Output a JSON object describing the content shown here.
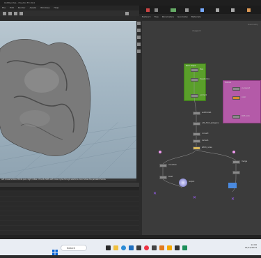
{
  "window": {
    "title": "Untitled.hip - Houdini FX 20.0"
  },
  "menubar": {
    "items": [
      "File",
      "Edit",
      "Render",
      "Assets",
      "Windows",
      "Help"
    ]
  },
  "network_tabs": {
    "items": [
      "Network",
      "Tree",
      "Parameters",
      "Geometry",
      "Materials"
    ]
  },
  "viewport": {
    "status_text": "Left mouse tumbles. Middle pans. Right dollies. Ctrl+Alt+Shift+Left mouse cycles through selections. Alt+P shows the persistent handle."
  },
  "network": {
    "context_label": "Geometry",
    "path": "obj/geo1",
    "nodes": [
      {
        "label": "file1"
      },
      {
        "label": "transform1"
      },
      {
        "label": "normal1"
      },
      {
        "label": "subdivide1"
      },
      {
        "label": "vdb_from_polygons"
      },
      {
        "label": "convert"
      },
      {
        "label": "remesh"
      },
      {
        "label": "attrib_noise"
      },
      {
        "label": "mountain"
      },
      {
        "label": "blast"
      },
      {
        "label": "output"
      },
      {
        "label": "merge"
      },
      {
        "label": "uv_layout"
      },
      {
        "label": "color"
      },
      {
        "label": "OUT_rock"
      }
    ],
    "green_box": {
      "label": "Rock shape"
    },
    "pink_box": {
      "label": "Texture"
    }
  },
  "taskbar": {
    "search_placeholder": "Search",
    "time": "12:00",
    "date": "01/01/2024"
  },
  "colors": {
    "viewport_sky": "#a4b7c4",
    "net_bg": "#3b3b3b",
    "green_box": "#5a9f2a",
    "pink_box": "#b45aa8",
    "taskbar": "#e9edf3"
  }
}
